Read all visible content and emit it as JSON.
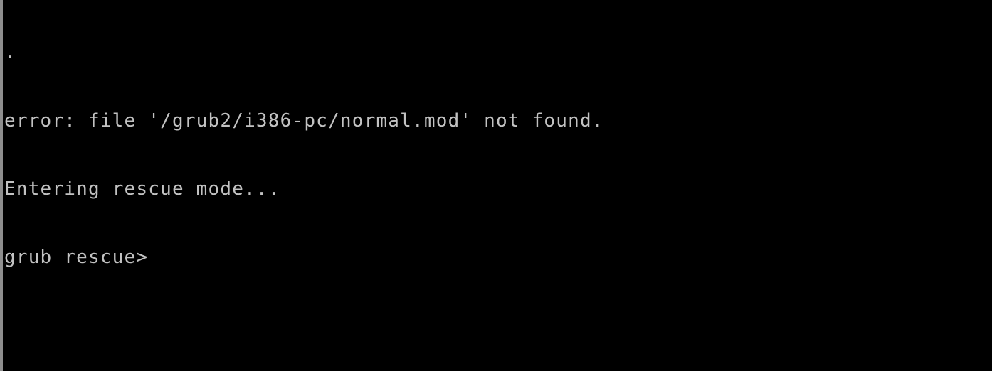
{
  "terminal": {
    "background": "#000000",
    "foreground": "#c2c2c2",
    "lines": [
      ".",
      "error: file '/grub2/i386-pc/normal.mod' not found.",
      "Entering rescue mode..."
    ],
    "prompt": "grub rescue>"
  }
}
